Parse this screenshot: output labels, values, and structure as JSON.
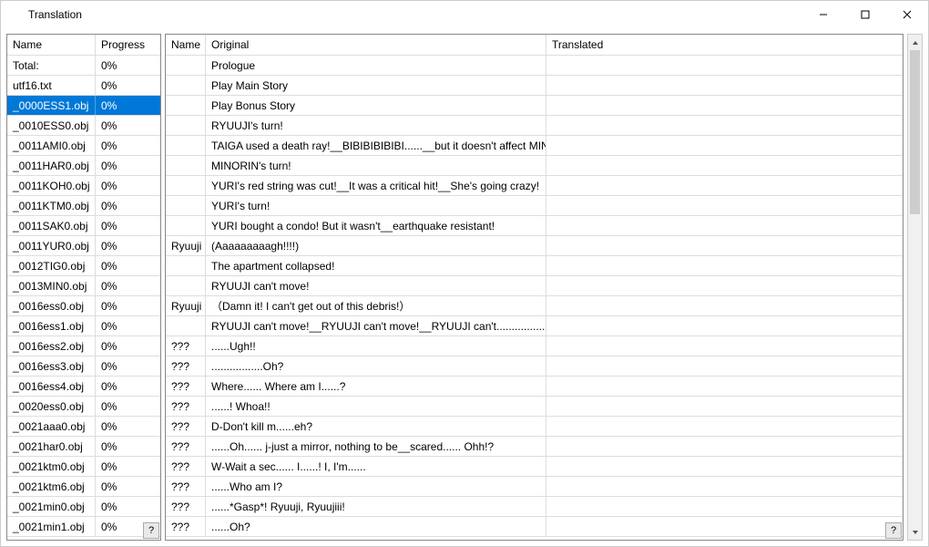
{
  "window": {
    "title": "Translation",
    "minimize": "—",
    "maximize": "☐",
    "close": "✕"
  },
  "left": {
    "headers": {
      "name": "Name",
      "progress": "Progress"
    },
    "rows": [
      {
        "name": "Total:",
        "progress": "0%",
        "selected": false
      },
      {
        "name": "utf16.txt",
        "progress": "0%",
        "selected": false
      },
      {
        "name": "_0000ESS1.obj",
        "progress": "0%",
        "selected": true
      },
      {
        "name": "_0010ESS0.obj",
        "progress": "0%",
        "selected": false
      },
      {
        "name": "_0011AMI0.obj",
        "progress": "0%",
        "selected": false
      },
      {
        "name": "_0011HAR0.obj",
        "progress": "0%",
        "selected": false
      },
      {
        "name": "_0011KOH0.obj",
        "progress": "0%",
        "selected": false
      },
      {
        "name": "_0011KTM0.obj",
        "progress": "0%",
        "selected": false
      },
      {
        "name": "_0011SAK0.obj",
        "progress": "0%",
        "selected": false
      },
      {
        "name": "_0011YUR0.obj",
        "progress": "0%",
        "selected": false
      },
      {
        "name": "_0012TIG0.obj",
        "progress": "0%",
        "selected": false
      },
      {
        "name": "_0013MIN0.obj",
        "progress": "0%",
        "selected": false
      },
      {
        "name": "_0016ess0.obj",
        "progress": "0%",
        "selected": false
      },
      {
        "name": "_0016ess1.obj",
        "progress": "0%",
        "selected": false
      },
      {
        "name": "_0016ess2.obj",
        "progress": "0%",
        "selected": false
      },
      {
        "name": "_0016ess3.obj",
        "progress": "0%",
        "selected": false
      },
      {
        "name": "_0016ess4.obj",
        "progress": "0%",
        "selected": false
      },
      {
        "name": "_0020ess0.obj",
        "progress": "0%",
        "selected": false
      },
      {
        "name": "_0021aaa0.obj",
        "progress": "0%",
        "selected": false
      },
      {
        "name": "_0021har0.obj",
        "progress": "0%",
        "selected": false
      },
      {
        "name": "_0021ktm0.obj",
        "progress": "0%",
        "selected": false
      },
      {
        "name": "_0021ktm6.obj",
        "progress": "0%",
        "selected": false
      },
      {
        "name": "_0021min0.obj",
        "progress": "0%",
        "selected": false
      },
      {
        "name": "_0021min1.obj",
        "progress": "0%",
        "selected": false
      }
    ],
    "help": "?"
  },
  "right": {
    "headers": {
      "name": "Name",
      "original": "Original",
      "translated": "Translated"
    },
    "rows": [
      {
        "name": "",
        "original": "Prologue",
        "translated": ""
      },
      {
        "name": "",
        "original": "Play Main Story",
        "translated": ""
      },
      {
        "name": "",
        "original": "Play Bonus Story",
        "translated": ""
      },
      {
        "name": "",
        "original": "RYUUJI's turn!",
        "translated": ""
      },
      {
        "name": "",
        "original": "TAIGA used a death ray!__BIBIBIBIBIBI......__but it doesn't affect MINORIN!",
        "translated": ""
      },
      {
        "name": "",
        "original": "MINORIN's turn!",
        "translated": ""
      },
      {
        "name": "",
        "original": "YURI's red string was cut!__It was a critical hit!__She's going crazy!",
        "translated": ""
      },
      {
        "name": "",
        "original": "YURI's turn!",
        "translated": ""
      },
      {
        "name": "",
        "original": "YURI bought a condo! But it wasn't__earthquake resistant!",
        "translated": ""
      },
      {
        "name": "Ryuuji",
        "original": "(Aaaaaaaaagh!!!!)",
        "translated": ""
      },
      {
        "name": "",
        "original": "The apartment collapsed!",
        "translated": ""
      },
      {
        "name": "",
        "original": "RYUUJI can't move!",
        "translated": ""
      },
      {
        "name": "Ryuuji",
        "original": "（Damn it! I can't get out of this debris!）",
        "translated": ""
      },
      {
        "name": "",
        "original": "RYUUJI can't move!__RYUUJI can't move!__RYUUJI can't..............................",
        "translated": ""
      },
      {
        "name": "???",
        "original": "......Ugh!!",
        "translated": ""
      },
      {
        "name": "???",
        "original": ".................Oh?",
        "translated": ""
      },
      {
        "name": "???",
        "original": "Where...... Where am I......?",
        "translated": ""
      },
      {
        "name": "???",
        "original": "......! Whoa!!",
        "translated": ""
      },
      {
        "name": "???",
        "original": "D-Don't kill m......eh?",
        "translated": ""
      },
      {
        "name": "???",
        "original": "......Oh...... j-just a mirror, nothing to be__scared...... Ohh!?",
        "translated": ""
      },
      {
        "name": "???",
        "original": "W-Wait a sec...... I......! I, I'm......",
        "translated": ""
      },
      {
        "name": "???",
        "original": "......Who am I?",
        "translated": ""
      },
      {
        "name": "???",
        "original": "......*Gasp*! Ryuuji, Ryuujiii!",
        "translated": ""
      },
      {
        "name": "???",
        "original": "......Oh?",
        "translated": ""
      }
    ],
    "help": "?"
  }
}
